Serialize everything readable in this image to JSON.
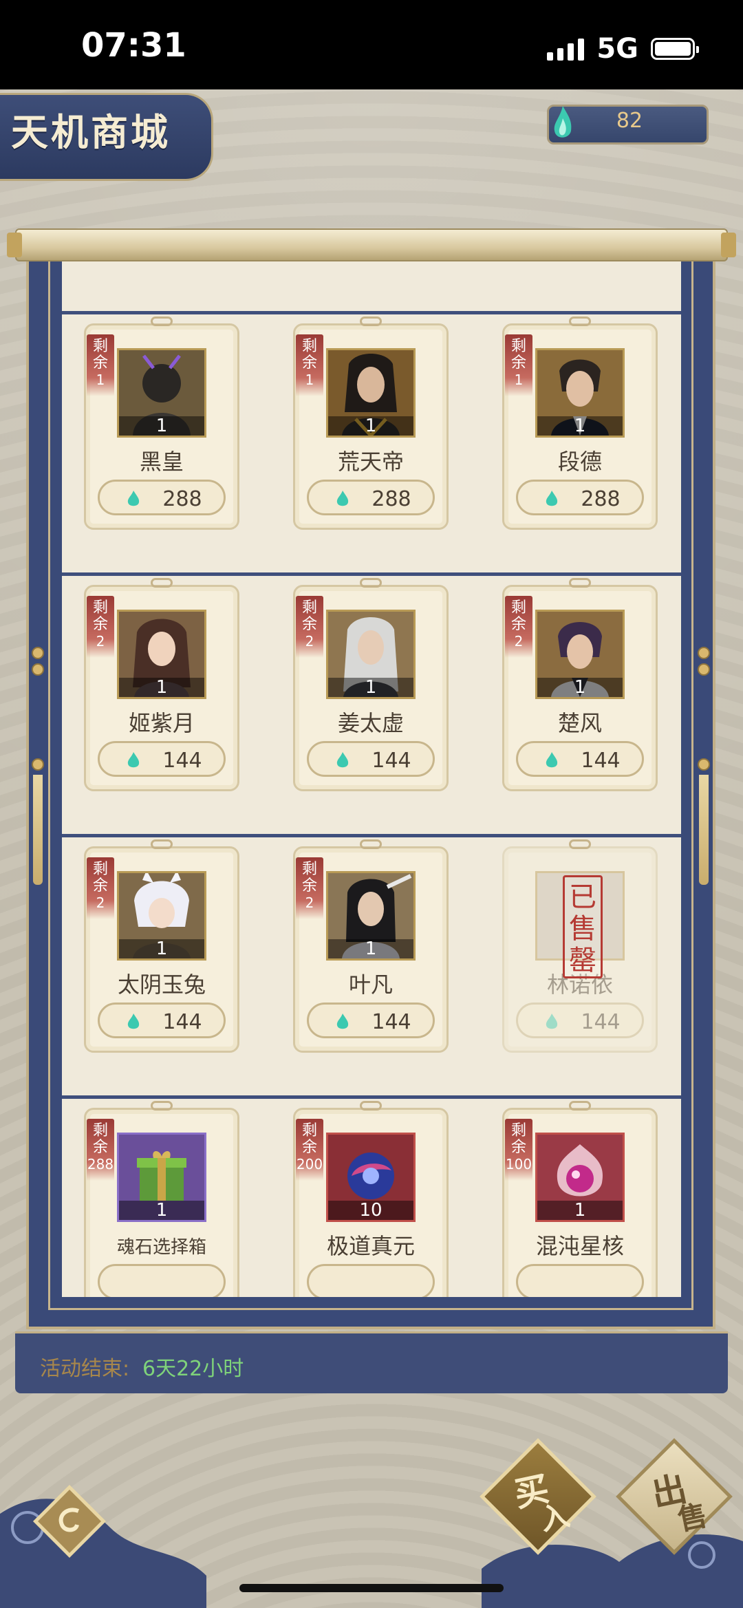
{
  "status_bar": {
    "time": "07:31",
    "network": "5G"
  },
  "header": {
    "title": "天机商城",
    "currency_value": "82"
  },
  "colors": {
    "panel_blue": "#3a4a78",
    "gold": "#c2b087",
    "paper": "#f0eadb",
    "remain_red": "#9a3a35",
    "event_green": "#7fd37a",
    "event_gold": "#a8874b"
  },
  "items": [
    {
      "remain_label": "剩余",
      "remain": "1",
      "qty": "1",
      "name": "黑皇",
      "price": "288",
      "sold": false
    },
    {
      "remain_label": "剩余",
      "remain": "1",
      "qty": "1",
      "name": "荒天帝",
      "price": "288",
      "sold": false
    },
    {
      "remain_label": "剩余",
      "remain": "1",
      "qty": "1",
      "name": "段德",
      "price": "288",
      "sold": false
    },
    {
      "remain_label": "剩余",
      "remain": "2",
      "qty": "1",
      "name": "姬紫月",
      "price": "144",
      "sold": false
    },
    {
      "remain_label": "剩余",
      "remain": "2",
      "qty": "1",
      "name": "姜太虚",
      "price": "144",
      "sold": false
    },
    {
      "remain_label": "剩余",
      "remain": "2",
      "qty": "1",
      "name": "楚风",
      "price": "144",
      "sold": false
    },
    {
      "remain_label": "剩余",
      "remain": "2",
      "qty": "1",
      "name": "太阴玉兔",
      "price": "144",
      "sold": false
    },
    {
      "remain_label": "剩余",
      "remain": "2",
      "qty": "1",
      "name": "叶凡",
      "price": "144",
      "sold": false
    },
    {
      "name": "林诺依",
      "price": "144",
      "sold": true,
      "stamp": "已售罄"
    },
    {
      "remain_label": "剩余",
      "remain": "288",
      "qty": "1",
      "name": "魂石选择箱",
      "sold": false
    },
    {
      "remain_label": "剩余",
      "remain": "200",
      "qty": "10",
      "name": "极道真元",
      "sold": false
    },
    {
      "remain_label": "剩余",
      "remain": "100",
      "qty": "1",
      "name": "混沌星核",
      "sold": false
    }
  ],
  "event": {
    "label": "活动结束:",
    "value": "6天22小时"
  },
  "actions": {
    "buy_1": "买",
    "buy_2": "入",
    "sell_1": "出",
    "sell_2": "售"
  }
}
